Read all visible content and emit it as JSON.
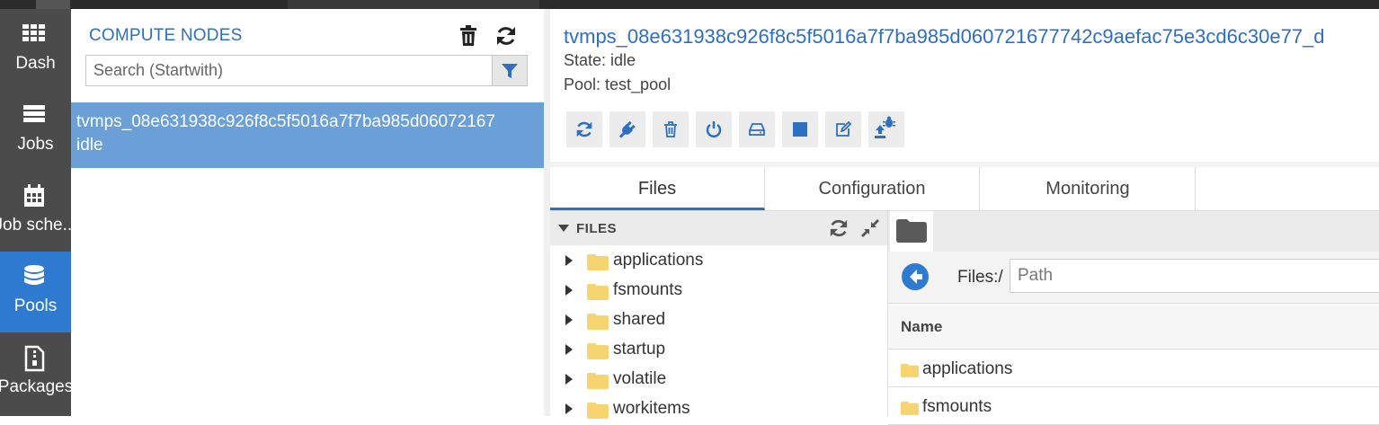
{
  "nav": {
    "items": [
      {
        "label": "Dash",
        "icon": "grid-icon"
      },
      {
        "label": "Jobs",
        "icon": "list-icon"
      },
      {
        "label": "Job sche...",
        "icon": "calendar-icon"
      },
      {
        "label": "Pools",
        "icon": "database-icon",
        "active": true
      },
      {
        "label": "Packages",
        "icon": "package-icon"
      }
    ]
  },
  "node_list": {
    "title": "COMPUTE NODES",
    "search_placeholder": "Search (Startwith)",
    "nodes": [
      {
        "id": "tvmps_08e631938c926f8c5f5016a7f7ba985d06072167",
        "state": "idle"
      }
    ]
  },
  "detail": {
    "title": "tvmps_08e631938c926f8c5f5016a7f7ba985d060721677742c9aefac75e3cd6c30e77_d",
    "state": "State: idle",
    "pool": "Pool: test_pool",
    "toolbar": [
      "refresh-icon",
      "plug-icon",
      "trash-icon",
      "power-icon",
      "drive-icon",
      "stop-icon",
      "edit-icon",
      "upload-bug-icon"
    ],
    "tabs": [
      "Files",
      "Configuration",
      "Monitoring"
    ],
    "active_tab": "Files"
  },
  "files": {
    "tree_title": "FILES",
    "tree_items": [
      "applications",
      "fsmounts",
      "shared",
      "startup",
      "volatile",
      "workitems"
    ],
    "path_label": "Files:/",
    "path_placeholder": "Path",
    "column_name": "Name",
    "rows": [
      "applications",
      "fsmounts"
    ]
  },
  "colors": {
    "accent": "#2f6fc0",
    "nav_bg": "#4b4b4b",
    "nav_active": "#2f7ad1",
    "selected_row": "#6a9fd8",
    "folder": "#f6d46f"
  }
}
